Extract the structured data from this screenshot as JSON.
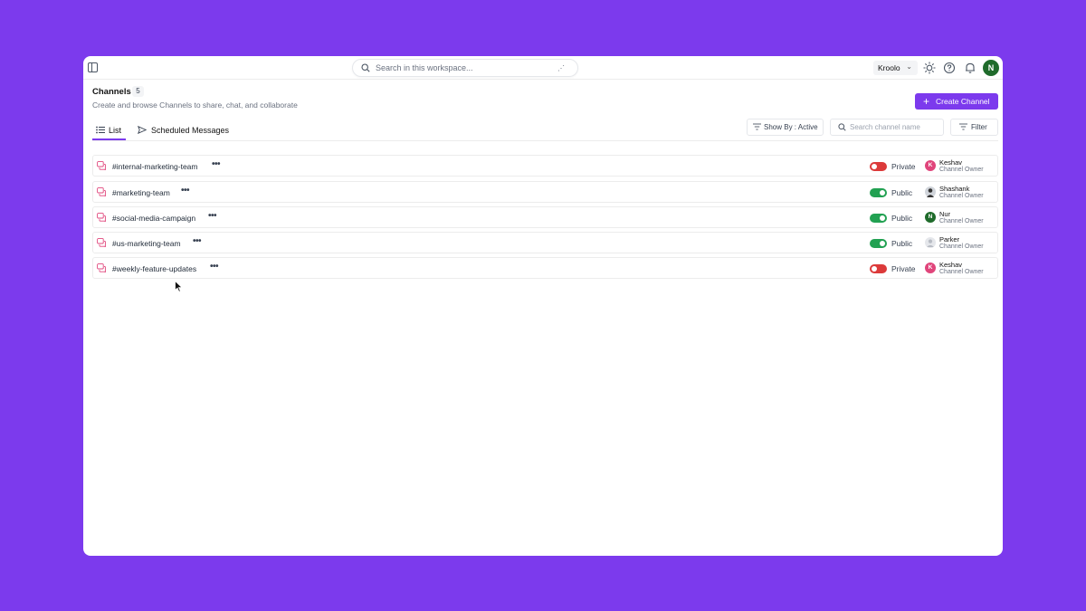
{
  "topbar": {
    "search_placeholder": "Search in this workspace...",
    "workspace": "Kroolo",
    "user_initial": "N"
  },
  "header": {
    "title": "Channels",
    "count": "5",
    "subtitle": "Create and browse Channels to share, chat, and collaborate",
    "create_label": "Create Channel"
  },
  "tabs": [
    {
      "label": "List",
      "active": true
    },
    {
      "label": "Scheduled Messages",
      "active": false
    }
  ],
  "toolbar": {
    "show_by": "Show By : Active",
    "search_placeholder": "Search channel name",
    "filter_label": "Filter"
  },
  "channels": [
    {
      "name": "#internal-marketing-team",
      "visibility": "Private",
      "owner": "Keshav",
      "owner_initial": "K",
      "role": "Channel Owner"
    },
    {
      "name": "#marketing-team",
      "visibility": "Public",
      "owner": "Shashank",
      "owner_initial": "",
      "role": "Channel Owner"
    },
    {
      "name": "#social-media-campaign",
      "visibility": "Public",
      "owner": "Nur",
      "owner_initial": "N",
      "role": "Channel Owner"
    },
    {
      "name": "#us-marketing-team",
      "visibility": "Public",
      "owner": "Parker",
      "owner_initial": "",
      "role": "Channel Owner"
    },
    {
      "name": "#weekly-feature-updates",
      "visibility": "Private",
      "owner": "Keshav",
      "owner_initial": "K",
      "role": "Channel Owner"
    }
  ],
  "colors": {
    "accent": "#7c3aed",
    "private": "#dc3a3a",
    "public": "#22a152"
  }
}
